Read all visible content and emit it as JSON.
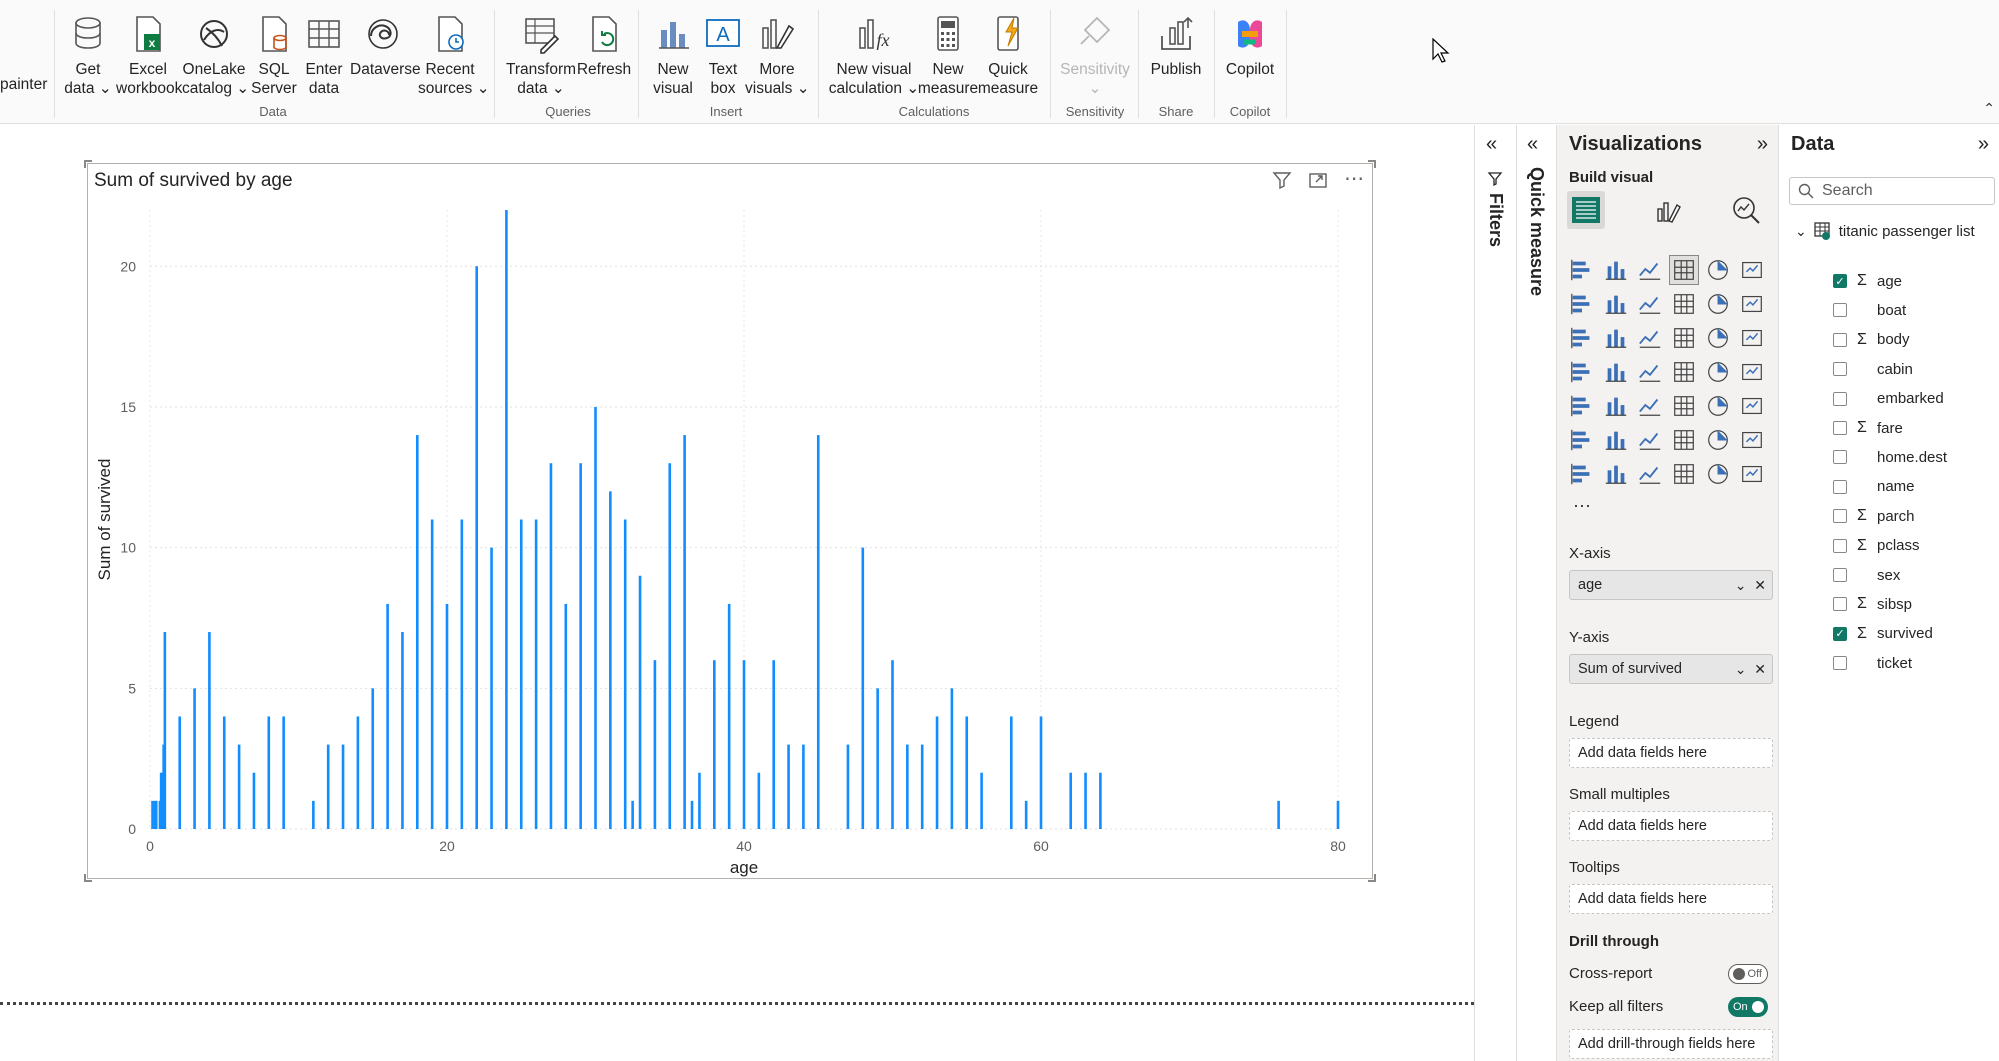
{
  "ribbon": {
    "painter_label": "painter",
    "data_group": {
      "label": "Data",
      "buttons": [
        {
          "l1": "Get",
          "l2": "data ⌄"
        },
        {
          "l1": "Excel",
          "l2": "workbook"
        },
        {
          "l1": "OneLake",
          "l2": "catalog ⌄"
        },
        {
          "l1": "SQL",
          "l2": "Server"
        },
        {
          "l1": "Enter",
          "l2": "data"
        },
        {
          "l1": "Dataverse",
          "l2": ""
        },
        {
          "l1": "Recent",
          "l2": "sources ⌄"
        }
      ]
    },
    "queries_group": {
      "label": "Queries",
      "buttons": [
        {
          "l1": "Transform",
          "l2": "data ⌄"
        },
        {
          "l1": "Refresh",
          "l2": ""
        }
      ]
    },
    "insert_group": {
      "label": "Insert",
      "buttons": [
        {
          "l1": "New",
          "l2": "visual"
        },
        {
          "l1": "Text",
          "l2": "box"
        },
        {
          "l1": "More",
          "l2": "visuals ⌄"
        }
      ]
    },
    "calculations_group": {
      "label": "Calculations",
      "buttons": [
        {
          "l1": "New visual",
          "l2": "calculation ⌄"
        },
        {
          "l1": "New",
          "l2": "measure"
        },
        {
          "l1": "Quick",
          "l2": "measure"
        }
      ]
    },
    "sensitivity_group": {
      "label": "Sensitivity",
      "buttons": [
        {
          "l1": "Sensitivity",
          "l2": "⌄"
        }
      ]
    },
    "share_group": {
      "label": "Share",
      "buttons": [
        {
          "l1": "Publish",
          "l2": ""
        }
      ]
    },
    "copilot_group": {
      "label": "Copilot",
      "buttons": [
        {
          "l1": "Copilot",
          "l2": ""
        }
      ]
    },
    "collapse_glyph": "⌃"
  },
  "visual": {
    "title": "Sum of survived by age",
    "tools": [
      "filter-icon",
      "focus-mode-icon",
      "more-options-icon"
    ],
    "more_glyph": "⋯"
  },
  "chart_data": {
    "type": "bar",
    "title": "Sum of survived by age",
    "xlabel": "age",
    "ylabel": "Sum of survived",
    "xlim": [
      0,
      80
    ],
    "ylim": [
      0,
      22
    ],
    "xticks": [
      0,
      20,
      40,
      60,
      80
    ],
    "yticks": [
      0,
      5,
      10,
      15,
      20
    ],
    "grid": true,
    "bar_color": "#118DFF",
    "x": [
      0.17,
      0.33,
      0.42,
      0.67,
      0.75,
      0.83,
      0.92,
      1,
      2,
      3,
      4,
      5,
      6,
      7,
      8,
      9,
      11,
      12,
      13,
      14,
      15,
      16,
      17,
      18,
      19,
      20,
      21,
      22,
      23,
      24,
      25,
      26,
      27,
      28,
      29,
      30,
      31,
      32,
      32.5,
      33,
      34,
      35,
      36,
      36.5,
      37,
      38,
      39,
      40,
      41,
      42,
      43,
      44,
      45,
      47,
      48,
      49,
      50,
      51,
      52,
      53,
      54,
      55,
      56,
      58,
      59,
      60,
      62,
      63,
      64,
      76,
      80
    ],
    "values": [
      1,
      1,
      1,
      1,
      2,
      2,
      3,
      7,
      4,
      5,
      7,
      4,
      3,
      2,
      4,
      4,
      1,
      3,
      3,
      4,
      5,
      8,
      7,
      14,
      11,
      8,
      11,
      20,
      10,
      22,
      11,
      11,
      13,
      8,
      13,
      15,
      12,
      11,
      1,
      9,
      6,
      13,
      14,
      1,
      2,
      6,
      8,
      6,
      2,
      6,
      3,
      3,
      14,
      3,
      10,
      5,
      6,
      3,
      3,
      4,
      5,
      4,
      2,
      4,
      1,
      4,
      2,
      2,
      2,
      1,
      1
    ]
  },
  "panes": {
    "filters_label": "Filters",
    "quick_measure_label": "Quick measure",
    "collapse_glyph": "«",
    "expand_glyph": "»"
  },
  "viz_pane": {
    "title": "Visualizations",
    "build_visual_label": "Build visual",
    "more_dots": "···",
    "xaxis_label": "X-axis",
    "xaxis_field": "age",
    "yaxis_label": "Y-axis",
    "yaxis_field": "Sum of survived",
    "legend_label": "Legend",
    "small_multiples_label": "Small multiples",
    "tooltips_label": "Tooltips",
    "placeholder": "Add data fields here",
    "drill_through_label": "Drill through",
    "cross_report_label": "Cross-report",
    "cross_report_state": "Off",
    "keep_filters_label": "Keep all filters",
    "keep_filters_state": "On",
    "drillthrough_placeholder": "Add drill-through fields here",
    "dropdown_glyph": "⌄",
    "remove_glyph": "✕"
  },
  "data_pane": {
    "title": "Data",
    "search_placeholder": "Search",
    "table_name": "titanic passenger list",
    "sigma": "Σ",
    "check_glyph": "✓",
    "fields": [
      {
        "name": "age",
        "sigma": true,
        "checked": true
      },
      {
        "name": "boat",
        "sigma": false,
        "checked": false
      },
      {
        "name": "body",
        "sigma": true,
        "checked": false
      },
      {
        "name": "cabin",
        "sigma": false,
        "checked": false
      },
      {
        "name": "embarked",
        "sigma": false,
        "checked": false
      },
      {
        "name": "fare",
        "sigma": true,
        "checked": false
      },
      {
        "name": "home.dest",
        "sigma": false,
        "checked": false
      },
      {
        "name": "name",
        "sigma": false,
        "checked": false
      },
      {
        "name": "parch",
        "sigma": true,
        "checked": false
      },
      {
        "name": "pclass",
        "sigma": true,
        "checked": false
      },
      {
        "name": "sex",
        "sigma": false,
        "checked": false
      },
      {
        "name": "sibsp",
        "sigma": true,
        "checked": false
      },
      {
        "name": "survived",
        "sigma": true,
        "checked": true
      },
      {
        "name": "ticket",
        "sigma": false,
        "checked": false
      }
    ]
  },
  "colors": {
    "accent": "#117865",
    "bar": "#118DFF"
  }
}
